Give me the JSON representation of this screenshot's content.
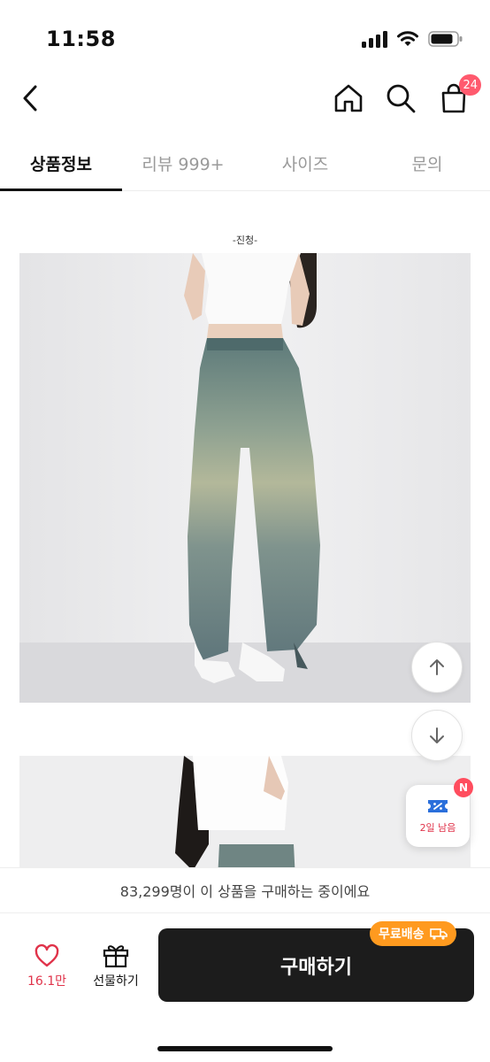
{
  "status_bar": {
    "time": "11:58"
  },
  "top_nav": {
    "cart_count": "24"
  },
  "tabs": [
    {
      "label": "상품정보"
    },
    {
      "label": "리뷰 999+"
    },
    {
      "label": "사이즈"
    },
    {
      "label": "문의"
    }
  ],
  "content": {
    "caption": "-진청-"
  },
  "coupon": {
    "badge": "N",
    "label": "2일 남음"
  },
  "buying_banner": "83,299명이 이 상품을 구매하는 중이에요",
  "bottom_bar": {
    "like_count": "16.1만",
    "gift_label": "선물하기",
    "buy_label": "구매하기",
    "shipping_badge": "무료배송"
  },
  "colors": {
    "accent": "#e0334a",
    "badge": "#ff5a6e",
    "buy": "#1c1c1c",
    "shipping": "#ff9a1f"
  }
}
